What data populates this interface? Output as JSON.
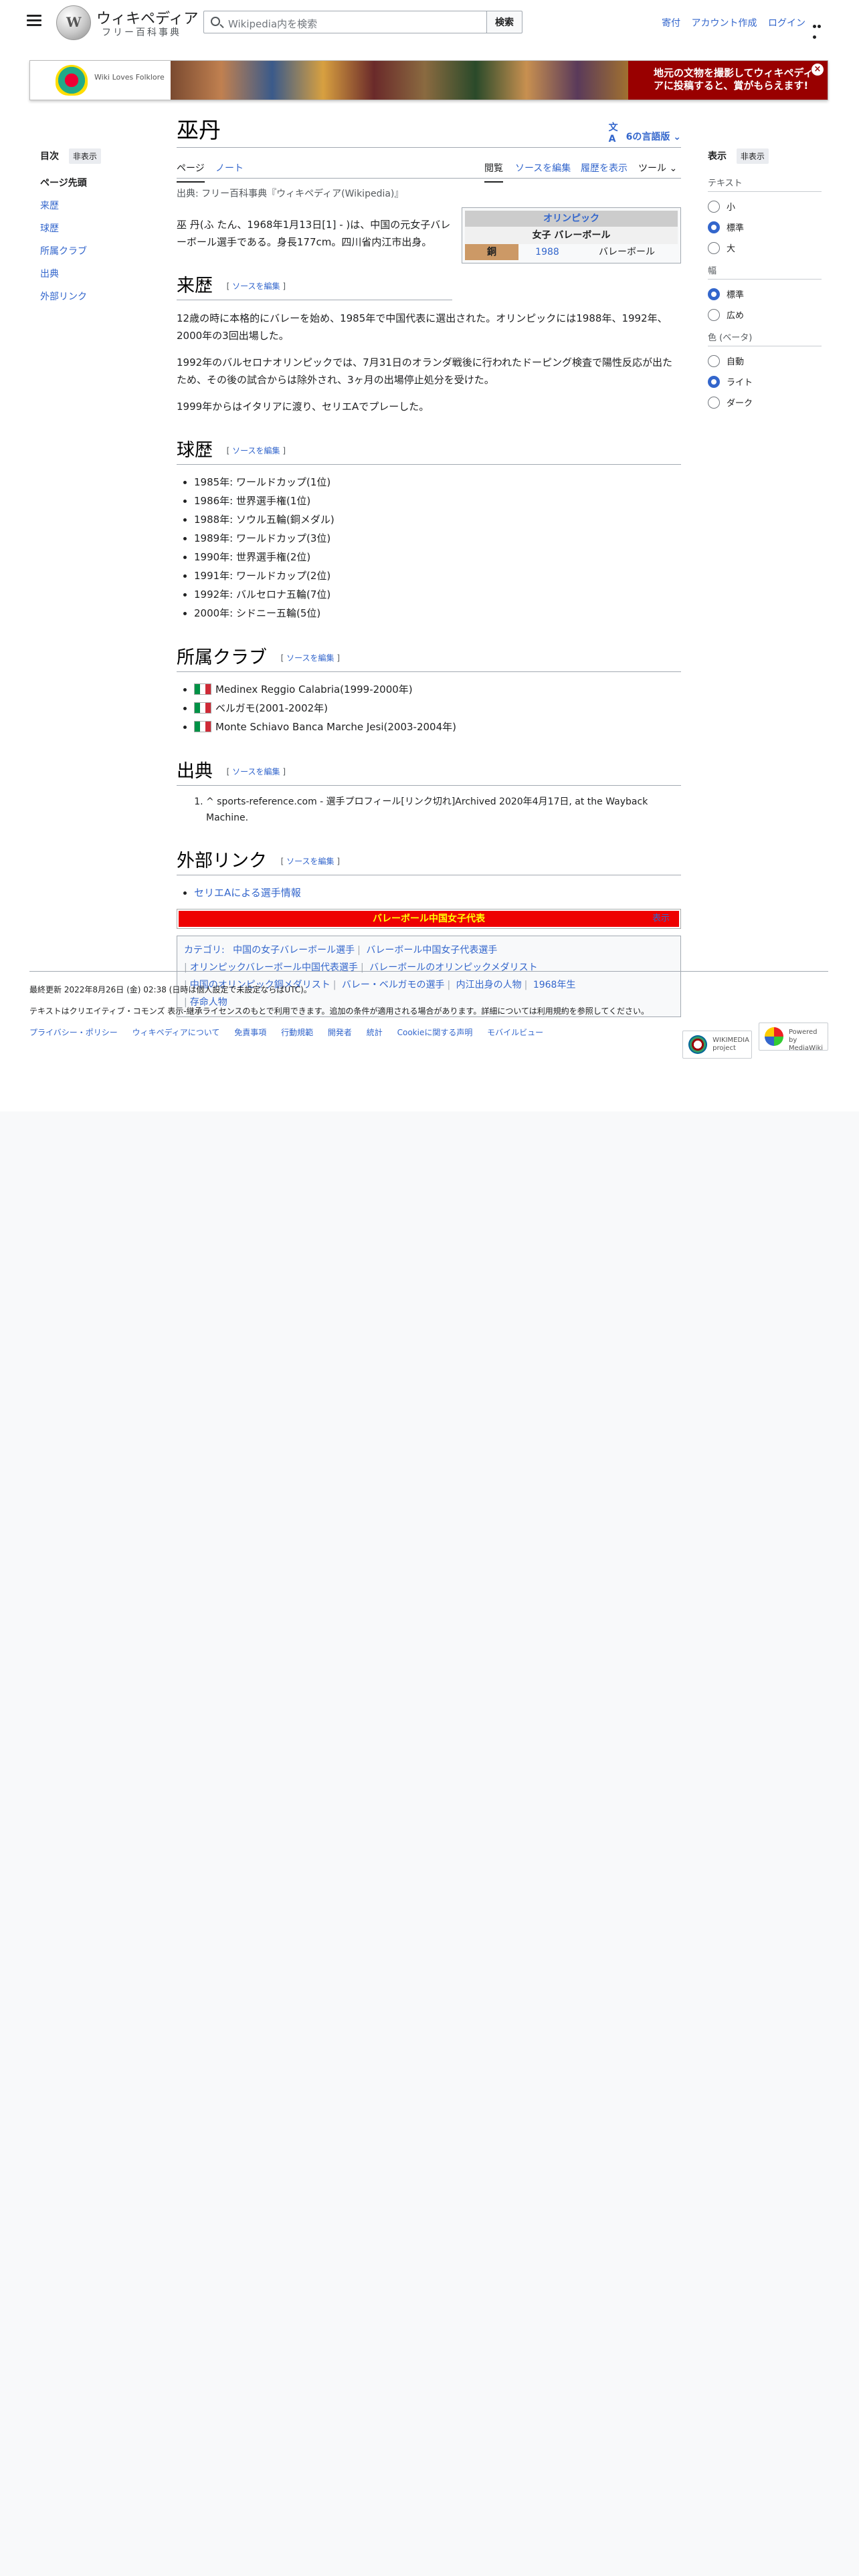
{
  "header": {
    "logo_title": "ウィキペディア",
    "logo_tagline": "フリー百科事典",
    "search_placeholder": "Wikipedia内を検索",
    "search_button": "検索",
    "links": [
      "寄付",
      "アカウント作成",
      "ログイン"
    ]
  },
  "banner": {
    "logo_text": "Wiki Loves Folklore",
    "message": "地元の文物を撮影してウィキペディアに投稿すると、賞がもらえます!",
    "close": "×"
  },
  "toc": {
    "title": "目次",
    "hide": "非表示",
    "items": [
      "ページ先頭",
      "来歴",
      "球歴",
      "所属クラブ",
      "出典",
      "外部リンク"
    ]
  },
  "article": {
    "title": "巫丹",
    "languages": "6の言語版",
    "tabs": {
      "page": "ページ",
      "talk": "ノート",
      "read": "閲覧",
      "edit": "ソースを編集",
      "history": "履歴を表示",
      "tools": "ツール"
    },
    "source": "出典: フリー百科事典『ウィキペディア(Wikipedia)』",
    "intro": "巫 丹(ふ たん、1968年1月13日[1] - )は、中国の元女子バレーボール選手である。身長177cm。四川省内江市出身。",
    "infobox": {
      "title": "オリンピック",
      "subtitle": "女子 バレーボール",
      "medal": "銅",
      "year": "1988",
      "event": "バレーボール"
    },
    "edit_link": "ソースを編集",
    "sections": {
      "history": {
        "title": "来歴",
        "paras": [
          "12歳の時に本格的にバレーを始め、1985年で中国代表に選出された。オリンピックには1988年、1992年、2000年の3回出場した。",
          "1992年のバルセロナオリンピックでは、7月31日のオランダ戦後に行われたドーピング検査で陽性反応が出たため、その後の試合からは除外され、3ヶ月の出場停止処分を受けた。",
          "1999年からはイタリアに渡り、セリエAでプレーした。"
        ]
      },
      "career": {
        "title": "球歴",
        "items": [
          "1985年: ワールドカップ(1位)",
          "1986年: 世界選手権(1位)",
          "1988年: ソウル五輪(銅メダル)",
          "1989年: ワールドカップ(3位)",
          "1990年: 世界選手権(2位)",
          "1991年: ワールドカップ(2位)",
          "1992年: バルセロナ五輪(7位)",
          "2000年: シドニー五輪(5位)"
        ]
      },
      "clubs": {
        "title": "所属クラブ",
        "items": [
          "Medinex Reggio Calabria(1999-2000年)",
          "ベルガモ(2001-2002年)",
          "Monte Schiavo Banca Marche Jesi(2003-2004年)"
        ]
      },
      "refs": {
        "title": "出典",
        "items": [
          "^ sports-reference.com - 選手プロフィール[リンク切れ]Archived 2020年4月17日, at the Wayback Machine."
        ]
      },
      "links": {
        "title": "外部リンク",
        "items": [
          "セリエAによる選手情報"
        ]
      }
    },
    "navbox": {
      "title": "バレーボール中国女子代表",
      "toggle": "表示"
    },
    "categories": {
      "label": "カテゴリ:",
      "items": [
        "中国の女子バレーボール選手",
        "バレーボール中国女子代表選手",
        "オリンピックバレーボール中国代表選手",
        "バレーボールのオリンピックメダリスト",
        "中国のオリンピック銅メダリスト",
        "バレー・ベルガモの選手",
        "内江出身の人物",
        "1968年生",
        "存命人物"
      ]
    }
  },
  "appearance": {
    "title": "表示",
    "hide": "非表示",
    "text_label": "テキスト",
    "text_options": [
      "小",
      "標準",
      "大"
    ],
    "text_selected": "標準",
    "width_label": "幅",
    "width_options": [
      "標準",
      "広め"
    ],
    "width_selected": "標準",
    "color_label": "色 (ベータ)",
    "color_options": [
      "自動",
      "ライト",
      "ダーク"
    ],
    "color_selected": "ライト"
  },
  "footer": {
    "last_edit": "最終更新 2022年8月26日 (金) 02:38 (日時は個人設定で未設定ならばUTC)。",
    "license": "テキストはクリエイティブ・コモンズ 表示-継承ライセンスのもとで利用できます。追加の条件が適用される場合があります。詳細については利用規約を参照してください。",
    "links": [
      "プライバシー・ポリシー",
      "ウィキペディアについて",
      "免責事項",
      "行動規範",
      "開発者",
      "統計",
      "Cookieに関する声明",
      "モバイルビュー"
    ],
    "badges": [
      "WIKIMEDIA project",
      "Powered by MediaWiki"
    ]
  }
}
